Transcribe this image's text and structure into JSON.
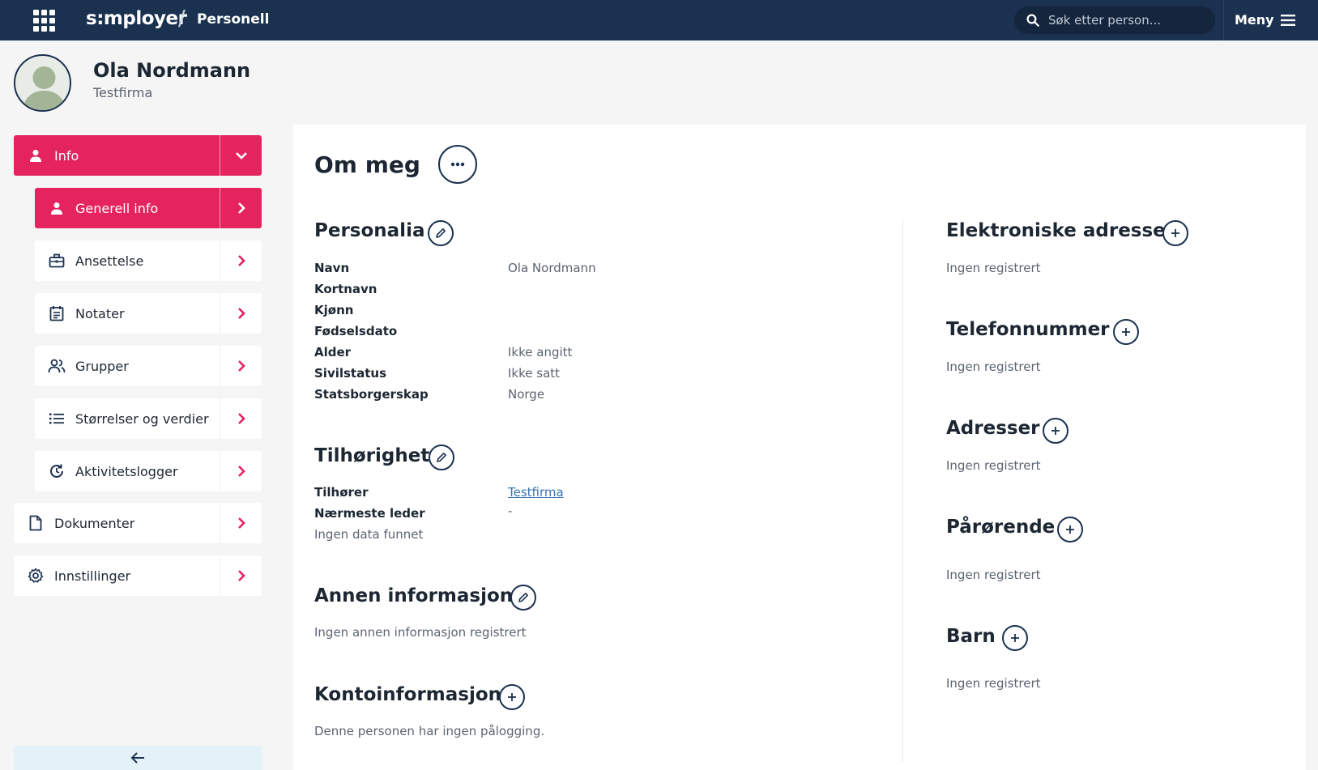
{
  "topbar": {
    "brand": "s:mployer",
    "separator": "/",
    "module": "Personell",
    "search_placeholder": "Søk etter person...",
    "menu_label": "Meny"
  },
  "person": {
    "name": "Ola Nordmann",
    "company": "Testfirma"
  },
  "sidebar": {
    "items": [
      {
        "label": "Info",
        "icon": "person-icon",
        "expanded": true
      },
      {
        "label": "Generell info",
        "icon": "person-icon",
        "active": true
      },
      {
        "label": "Ansettelse",
        "icon": "briefcase-icon"
      },
      {
        "label": "Notater",
        "icon": "notes-icon"
      },
      {
        "label": "Grupper",
        "icon": "group-icon"
      },
      {
        "label": "Størrelser og verdier",
        "icon": "list-icon"
      },
      {
        "label": "Aktivitetslogger",
        "icon": "history-icon"
      },
      {
        "label": "Dokumenter",
        "icon": "document-icon"
      },
      {
        "label": "Innstillinger",
        "icon": "settings-icon"
      }
    ]
  },
  "main": {
    "title": "Om meg",
    "personalia": {
      "title": "Personalia",
      "rows": [
        {
          "label": "Navn",
          "value": "Ola Nordmann"
        },
        {
          "label": "Kortnavn",
          "value": ""
        },
        {
          "label": "Kjønn",
          "value": ""
        },
        {
          "label": "Fødselsdato",
          "value": ""
        },
        {
          "label": "Alder",
          "value": "Ikke angitt"
        },
        {
          "label": "Sivilstatus",
          "value": "Ikke satt"
        },
        {
          "label": "Statsborgerskap",
          "value": "Norge"
        }
      ]
    },
    "tilhorighet": {
      "title": "Tilhørighet",
      "belongs_label": "Tilhører",
      "belongs_value": "Testfirma",
      "manager_label": "Nærmeste leder",
      "manager_value": "-",
      "empty": "Ingen data funnet"
    },
    "annen": {
      "title": "Annen informasjon",
      "empty": "Ingen annen informasjon registrert"
    },
    "konto": {
      "title": "Kontoinformasjon",
      "empty": "Denne personen har ingen pålogging."
    },
    "right": [
      {
        "title": "Elektroniske adresser",
        "empty": "Ingen registrert"
      },
      {
        "title": "Telefonnummer",
        "empty": "Ingen registrert"
      },
      {
        "title": "Adresser",
        "empty": "Ingen registrert"
      },
      {
        "title": "Pårørende",
        "empty": "Ingen registrert"
      },
      {
        "title": "Barn",
        "empty": "Ingen registrert"
      }
    ]
  },
  "colors": {
    "topbar": "#1b3150",
    "accent": "#e4235f",
    "link": "#3873b5"
  }
}
